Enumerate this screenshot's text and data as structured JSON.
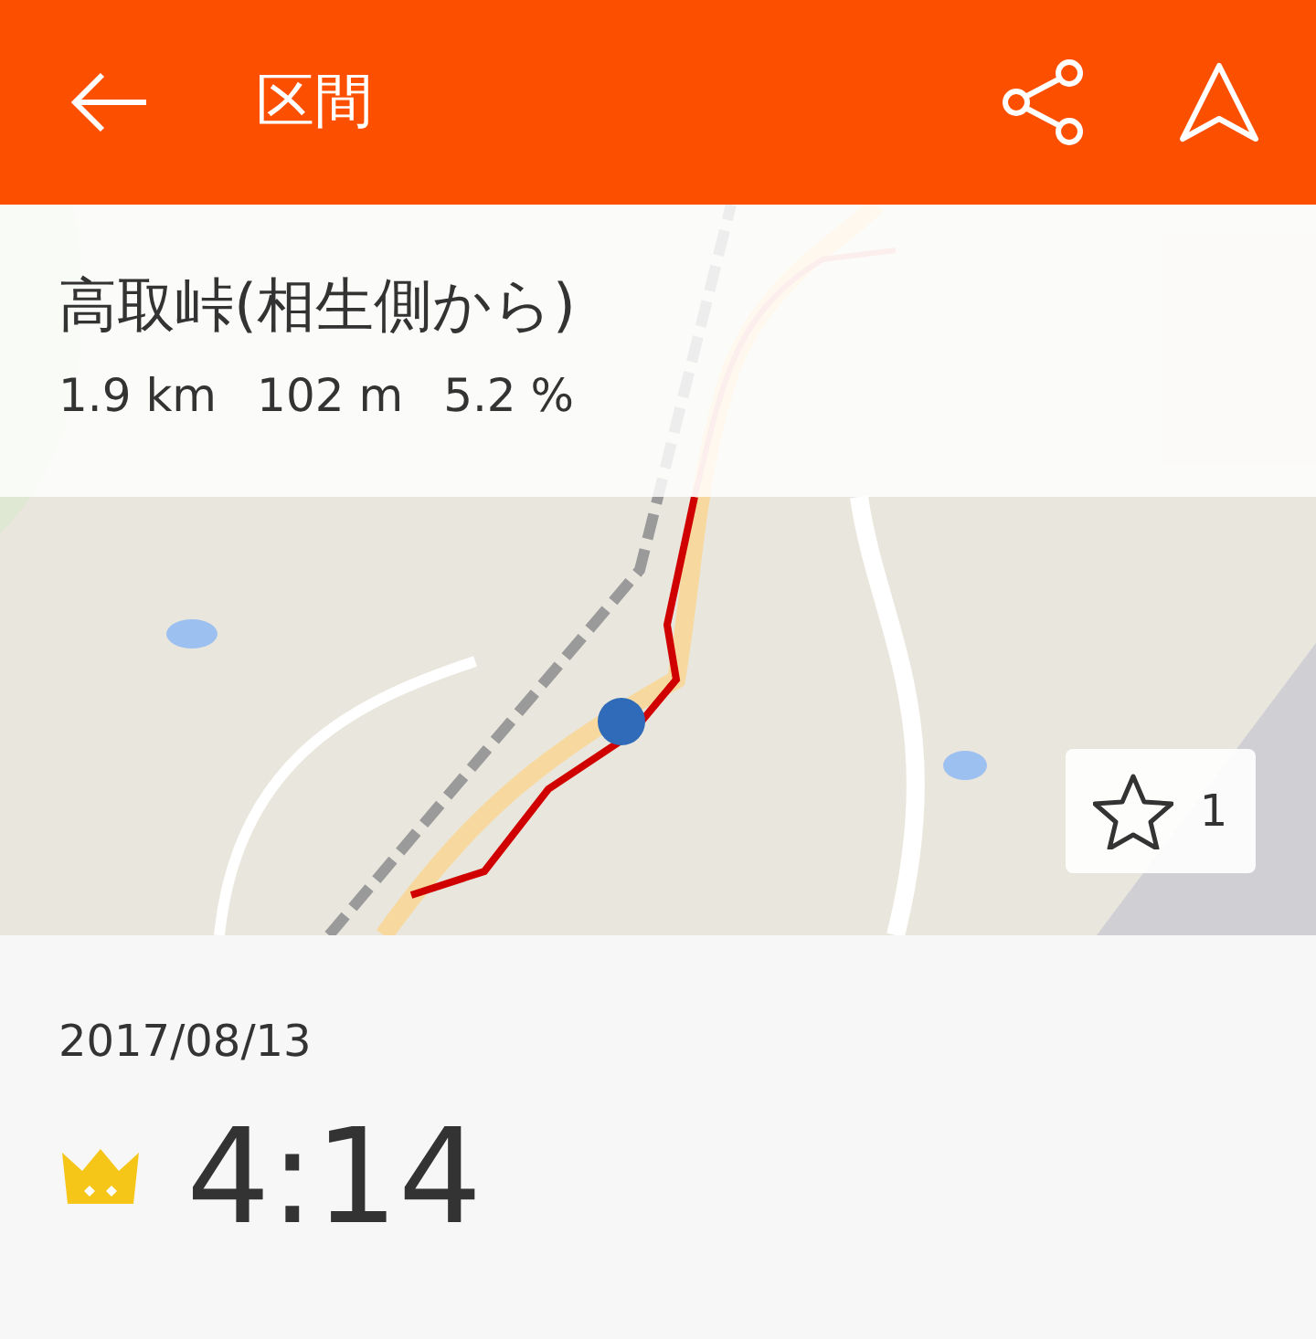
{
  "header": {
    "title": "区間"
  },
  "segment": {
    "name": "高取峠(相生側から)",
    "stats": [
      "1.9 km",
      "102 m",
      "5.2 %"
    ]
  },
  "star": {
    "count": "1",
    "starred": false
  },
  "effort": {
    "date": "2017/08/13",
    "time": "4:14"
  }
}
